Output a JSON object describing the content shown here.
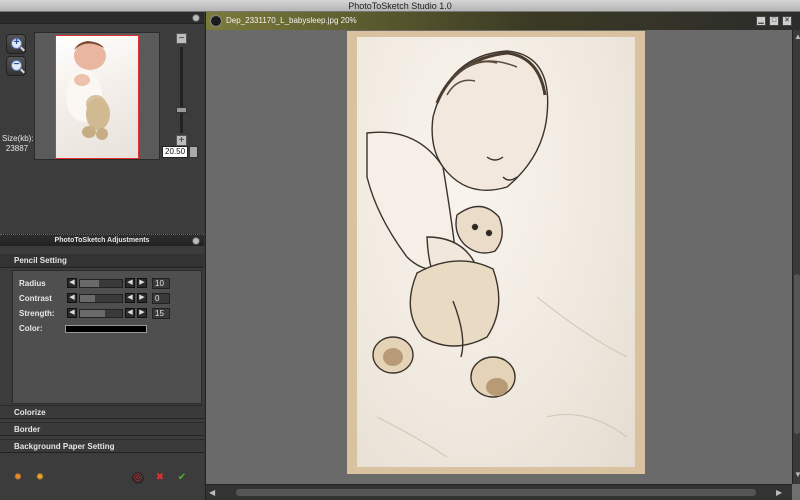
{
  "window": {
    "title": "PhotoToSketch Studio 1.0"
  },
  "navigator": {
    "size_label": "Size(kb):",
    "size_value": "23887",
    "zoom_value": "20.50",
    "zoom_plus": "+",
    "zoom_minus": "−",
    "zoom_in_glyph": "+",
    "zoom_out_glyph": "−"
  },
  "adjustments": {
    "title": "PhotoToSketch Adjustments",
    "pencil_setting": {
      "title": "Pencil Setting",
      "radius": {
        "label": "Radius",
        "value": "10",
        "level": 0.45
      },
      "contrast": {
        "label": "Contrast",
        "value": "0",
        "level": 0.35
      },
      "strength": {
        "label": "Strength:",
        "value": "15",
        "level": 0.6
      },
      "color": {
        "label": "Color:",
        "swatch": "#000000"
      }
    },
    "colorize": "Colorize",
    "border": "Border",
    "background_paper": "Background Paper Setting"
  },
  "document": {
    "tab_label": "Dep_2331170_L_babysleep.jpg 20%"
  },
  "icons": {
    "arrow_left": "◀",
    "arrow_right": "▶",
    "minimize": "▁",
    "maximize": "□",
    "close": "✕",
    "gear": "✹",
    "gear2": "✹",
    "reset": "◎",
    "cancel": "✖",
    "apply": "✔",
    "scroll_left": "◀",
    "scroll_right": "▶",
    "scroll_up": "▲",
    "scroll_down": "▼"
  },
  "colors": {
    "accent_red": "#e03030",
    "apply_green": "#4caf2a"
  }
}
